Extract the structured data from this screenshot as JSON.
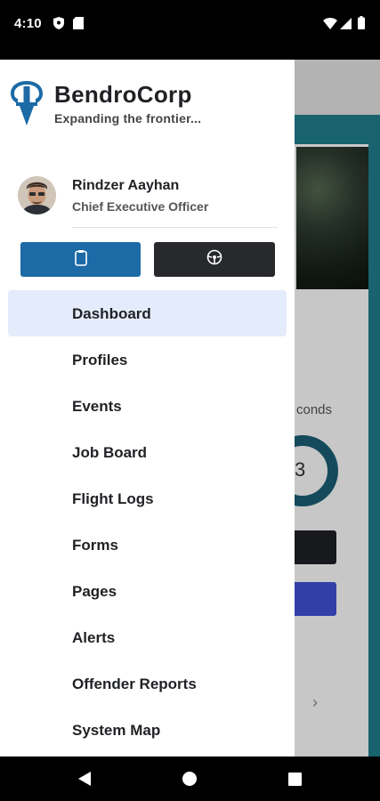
{
  "status_bar": {
    "time": "4:10"
  },
  "drawer": {
    "brand": {
      "name": "BendroCorp",
      "tagline": "Expanding the frontier..."
    },
    "user": {
      "name": "Rindzer Aayhan",
      "role": "Chief Executive Officer"
    },
    "buttons": [
      {
        "icon": "clipboard-icon"
      },
      {
        "icon": "steering-wheel-icon"
      }
    ],
    "nav": [
      {
        "label": "Dashboard",
        "active": true
      },
      {
        "label": "Profiles"
      },
      {
        "label": "Events"
      },
      {
        "label": "Job Board"
      },
      {
        "label": "Flight Logs"
      },
      {
        "label": "Forms"
      },
      {
        "label": "Pages"
      },
      {
        "label": "Alerts"
      },
      {
        "label": "Offender Reports"
      },
      {
        "label": "System Map"
      }
    ]
  },
  "background": {
    "partial_text": "conds",
    "donut_partial": "3"
  },
  "colors": {
    "brand_blue": "#1c6aa6",
    "active_bg": "#e4ecfb",
    "dark_button": "#27292c"
  }
}
